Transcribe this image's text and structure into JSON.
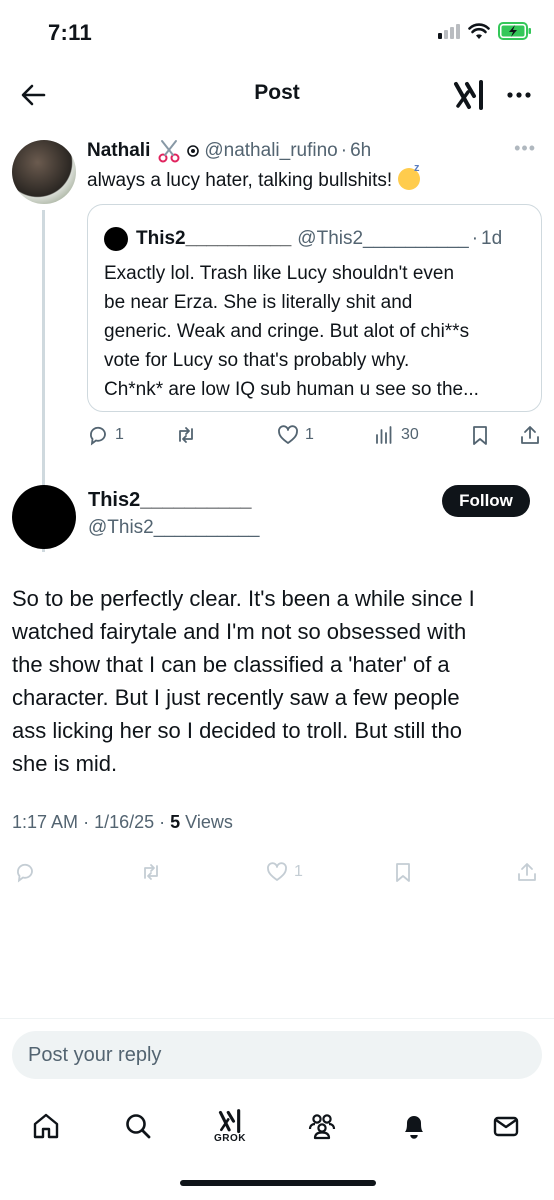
{
  "status_bar": {
    "time": "7:11"
  },
  "header": {
    "title": "Post"
  },
  "parent_tweet": {
    "name": "Nathali",
    "handle": "@nathali_rufino",
    "separator": "·",
    "age": "6h",
    "text": "always a lucy hater, talking bullshits!",
    "quoted": {
      "name": "This2__________",
      "handle": "@This2__________",
      "separator": "·",
      "age": "1d",
      "lines": [
        "Exactly lol. Trash like Lucy shouldn't even",
        "be near Erza. She is literally shit and",
        "generic. Weak and cringe. But alot of chi**s",
        "vote for Lucy so that's probably why.",
        "Ch*nk* are low IQ sub human u see so the..."
      ]
    },
    "stats": {
      "replies": "1",
      "reposts": "",
      "likes": "1",
      "views": "30"
    }
  },
  "main_tweet": {
    "name": "This2__________",
    "handle": "@This2__________",
    "follow_label": "Follow",
    "body_lines": [
      "So to be perfectly clear. It's been a while since I",
      "watched fairytale and I'm not so obsessed with",
      "the show that I can be classified a 'hater' of a",
      "character. But I just recently saw a few people",
      "ass licking her so I decided to troll. But still tho",
      "she is mid."
    ],
    "time": "1:17 AM",
    "date": "1/16/25",
    "views_count": "5",
    "views_label": "Views",
    "stats": {
      "likes": "1"
    }
  },
  "reply": {
    "placeholder": "Post your reply"
  },
  "tabbar": {
    "grok_label": "GROK"
  },
  "icons": [
    "back-arrow-icon",
    "grok-logo-icon",
    "more-icon",
    "reply-icon",
    "repost-icon",
    "like-icon",
    "views-icon",
    "bookmark-icon",
    "share-icon",
    "home-icon",
    "search-icon",
    "grok-icon",
    "communities-icon",
    "notifications-icon",
    "messages-icon"
  ]
}
